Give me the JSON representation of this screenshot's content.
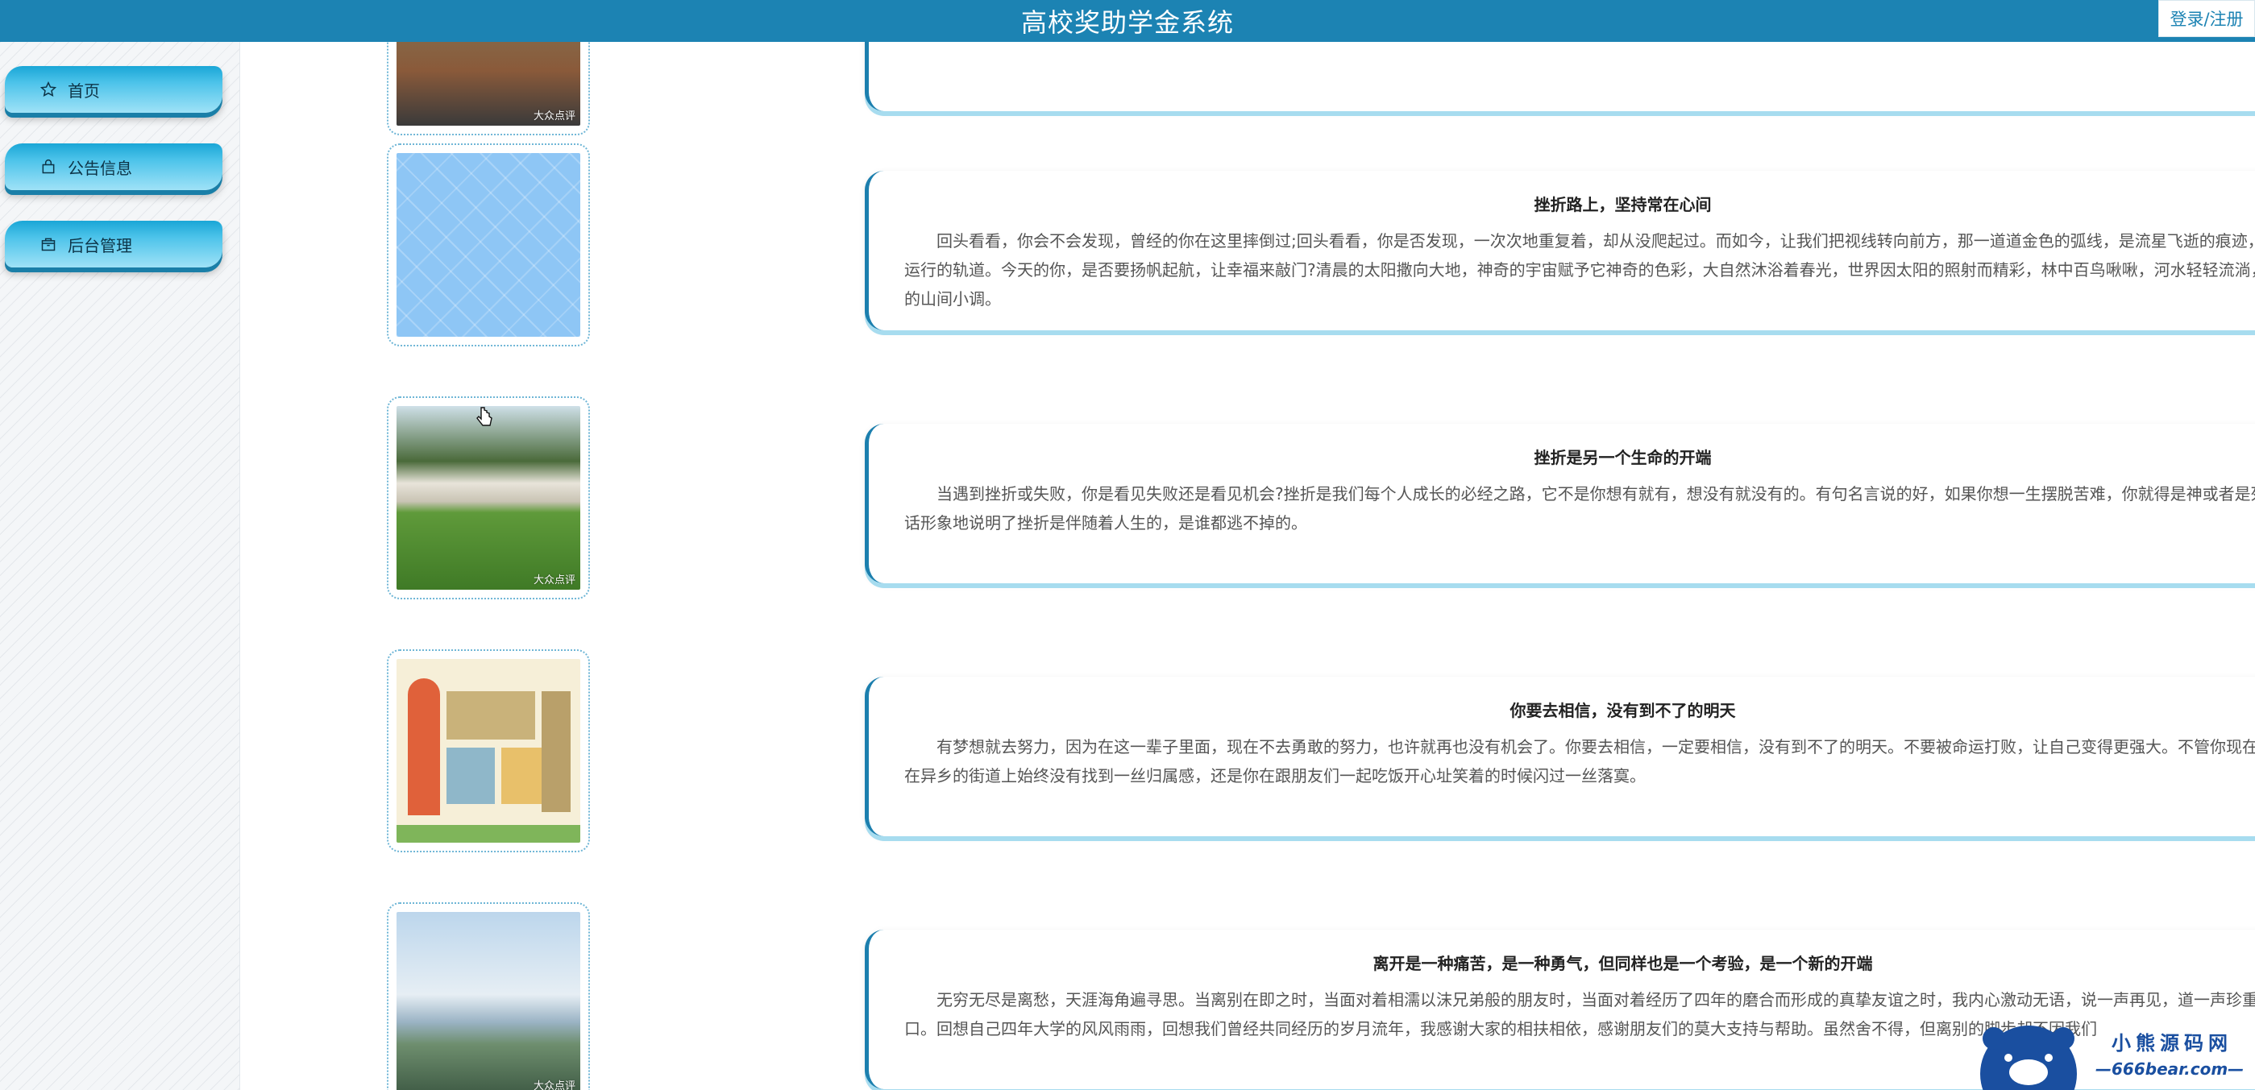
{
  "header": {
    "title": "高校奖助学金系统",
    "login_label": "登录/注册"
  },
  "sidebar": {
    "items": [
      {
        "label": "首页",
        "icon": "star-icon"
      },
      {
        "label": "公告信息",
        "icon": "bag-icon"
      },
      {
        "label": "后台管理",
        "icon": "box-icon"
      }
    ]
  },
  "posts": [
    {
      "title": "",
      "body": ""
    },
    {
      "title": "挫折路上，坚持常在心间",
      "body": "回头看看，你会不会发现，曾经的你在这里摔倒过;回头看看，你是否发现，一次次地重复着，却从没爬起过。而如今，让我们把视线转向前方，那一道道金色的弧线，是流星飞逝的痕迹，或是成功运行的轨道。今天的你，是否要扬帆起航，让幸福来敲门?清晨的太阳撒向大地，神奇的宇宙赋予它神奇的色彩，大自然沐浴着春光，世界因太阳的照射而精彩，林中百鸟啾啾，河水轻轻流淌，汇成清宁的山间小调。"
    },
    {
      "title": "挫折是另一个生命的开端",
      "body": "当遇到挫折或失败，你是看见失败还是看见机会?挫折是我们每个人成长的必经之路，它不是你想有就有，想没有就没有的。有句名言说的好，如果你想一生摆脱苦难，你就得是神或者是死尸。这句话形象地说明了挫折是伴随着人生的，是谁都逃不掉的。"
    },
    {
      "title": "你要去相信，没有到不了的明天",
      "body": "有梦想就去努力，因为在这一辈子里面，现在不去勇敢的努力，也许就再也没有机会了。你要去相信，一定要相信，没有到不了的明天。不要被命运打败，让自己变得更强大。不管你现在是一个人走在异乡的街道上始终没有找到一丝归属感，还是你在跟朋友们一起吃饭开心址笑着的时候闪过一丝落寞。"
    },
    {
      "title": "离开是一种痛苦，是一种勇气，但同样也是一个考验，是一个新的开端",
      "body": "无穷无尽是离愁，天涯海角遍寻思。当离别在即之时，当面对着相濡以沫兄弟般的朋友时，当面对着经历了四年的磨合而形成的真挚友谊之时，我内心激动无语，说一声再见，道一声珍重都很难出口。回想自己四年大学的风风雨雨，回想我们曾经共同经历的岁月流年，我感谢大家的相扶相依，感谢朋友们的莫大支持与帮助。虽然舍不得，但离别的脚步却不因我们"
    }
  ],
  "image_marks": {
    "dianping": "大众点评"
  },
  "watermark": {
    "line1": "小熊源码网",
    "line2": "—666bear.com—"
  },
  "colors": {
    "header": "#1c83b3",
    "accent": "#1c7fae",
    "menu_light": "#9fe2f7"
  }
}
